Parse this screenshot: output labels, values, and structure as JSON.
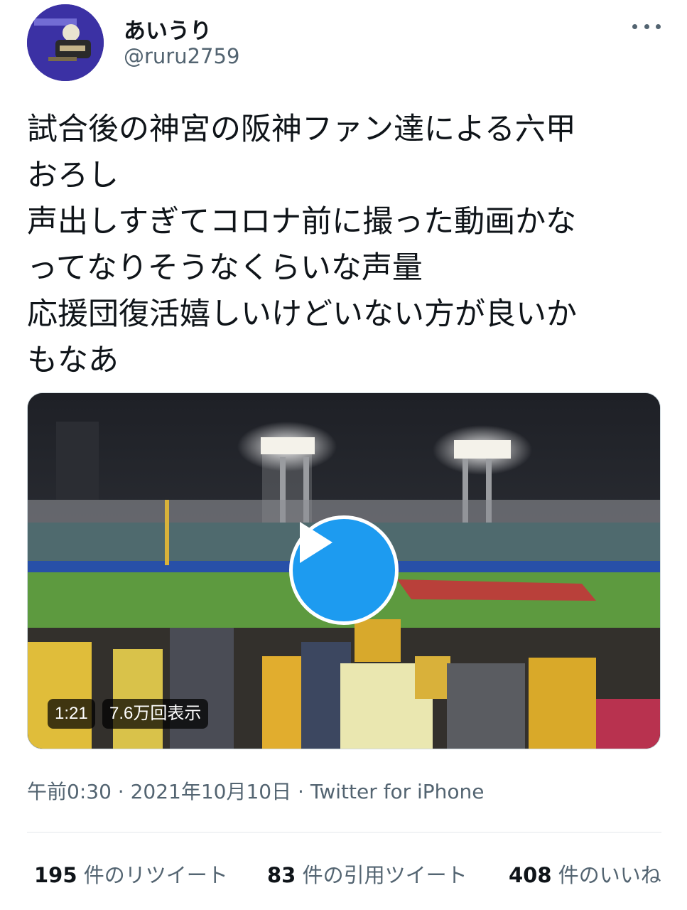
{
  "author": {
    "display_name": "あいうり",
    "handle": "@ruru2759"
  },
  "tweet": {
    "lines": [
      "試合後の神宮の阪神ファン達による六甲",
      "おろし",
      "声出しすぎてコロナ前に撮った動画かな",
      "ってなりそうなくらいな声量",
      "応援団復活嬉しいけどいない方が良いか",
      "もなあ"
    ]
  },
  "video": {
    "duration": "1:21",
    "views": "7.6万回表示"
  },
  "meta": {
    "time": "午前0:30",
    "separator1": "·",
    "date": "2021年10月10日",
    "separator2": "·",
    "source": "Twitter for iPhone"
  },
  "stats": {
    "retweets_count": "195",
    "retweets_label": " 件のリツイート",
    "quotes_count": "83",
    "quotes_label": " 件の引用ツイート",
    "likes_count": "408",
    "likes_label": " 件のいいね"
  },
  "icons": {
    "more": "more-horizontal-icon",
    "play": "play-icon"
  },
  "colors": {
    "accent": "#1d9bf0",
    "text": "#0f1419",
    "secondary": "#536471"
  }
}
